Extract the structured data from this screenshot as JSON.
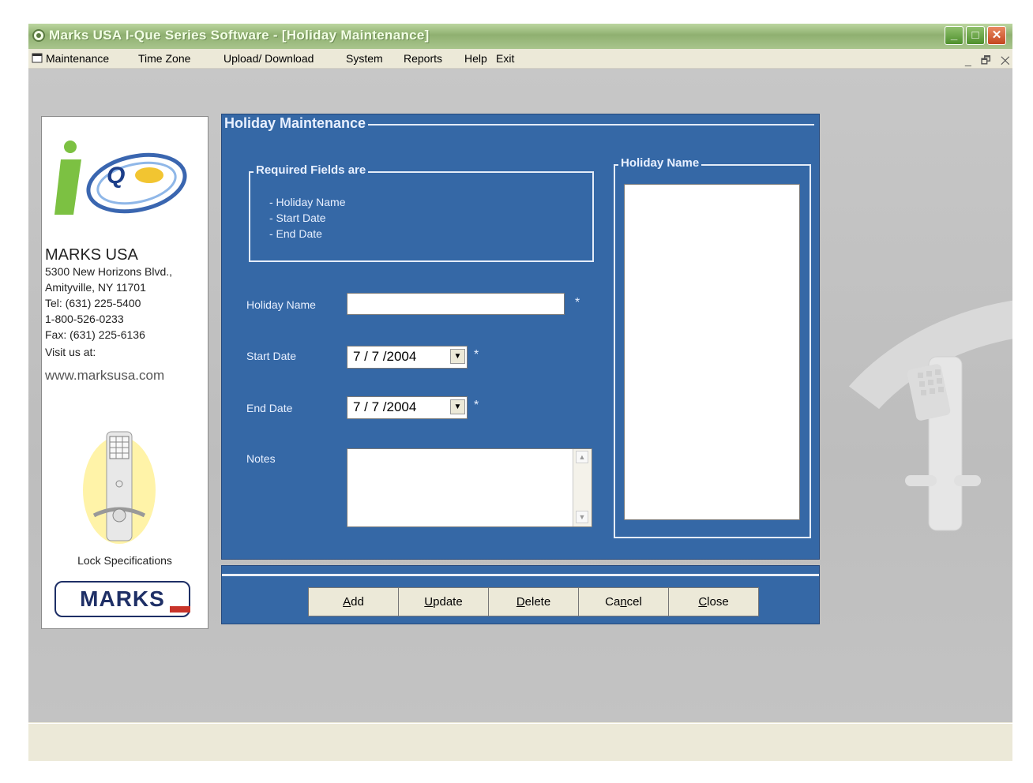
{
  "window": {
    "title": "Marks USA    I-Que Series Software - [Holiday Maintenance]",
    "controls": {
      "minimize": "_",
      "maximize": "□",
      "close": "✕"
    }
  },
  "menubar": {
    "items": [
      "Maintenance",
      "Time Zone",
      "Upload/ Download",
      "System",
      "Reports",
      "Help",
      "Exit"
    ],
    "mdi_controls": "_ 🗗 ✕"
  },
  "info_panel": {
    "company": "MARKS USA",
    "address_lines": [
      "5300 New Horizons Blvd.,",
      "Amityville, NY 11701",
      "Tel: (631) 225-5400",
      "1-800-526-0233",
      "Fax: (631) 225-6136",
      "Visit us at:"
    ],
    "website": "www.marksusa.com",
    "lock_spec_label": "Lock Specifications",
    "logo_text": "MARKS",
    "iq_logo_text": "Q"
  },
  "form": {
    "title": "Holiday Maintenance",
    "required": {
      "title": "Required Fields are",
      "items": [
        "- Holiday Name",
        "- Start Date",
        "- End Date"
      ]
    },
    "holiday_name_label": "Holiday Name",
    "holiday_name_value": "",
    "start_date_label": "Start Date",
    "start_date_value": "7 / 7 /2004",
    "end_date_label": "End Date",
    "end_date_value": "7 / 7 /2004",
    "notes_label": "Notes",
    "notes_value": "",
    "required_mark": "*",
    "list_title": "Holiday Name"
  },
  "buttons": {
    "add": {
      "pre": "",
      "key": "A",
      "post": "dd"
    },
    "update": {
      "pre": "",
      "key": "U",
      "post": "pdate"
    },
    "delete": {
      "pre": "",
      "key": "D",
      "post": "elete"
    },
    "cancel": {
      "pre": "Ca",
      "key": "n",
      "post": "cel"
    },
    "close": {
      "pre": "",
      "key": "C",
      "post": "lose"
    }
  },
  "colors": {
    "panel_blue": "#3568a6",
    "titlebar_green": "#8fb070",
    "mdi_gray": "#c0c0c0"
  }
}
